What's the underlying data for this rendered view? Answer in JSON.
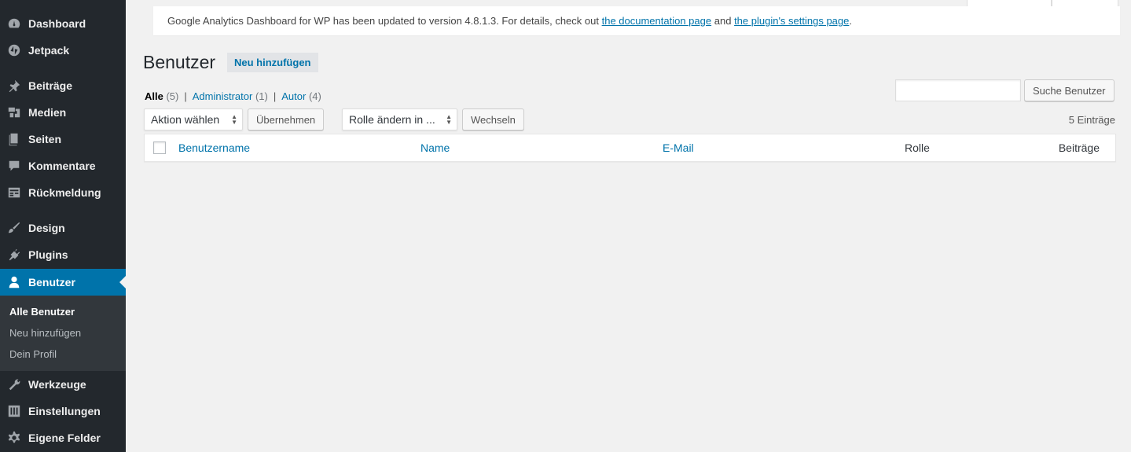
{
  "sidebar": {
    "items": [
      {
        "label": "Dashboard",
        "icon": "dashboard-icon"
      },
      {
        "label": "Jetpack",
        "icon": "jetpack-icon"
      },
      {
        "label": "Beiträge",
        "icon": "pin-icon"
      },
      {
        "label": "Medien",
        "icon": "media-icon"
      },
      {
        "label": "Seiten",
        "icon": "pages-icon"
      },
      {
        "label": "Kommentare",
        "icon": "comment-icon"
      },
      {
        "label": "Rückmeldung",
        "icon": "feedback-icon"
      },
      {
        "label": "Design",
        "icon": "brush-icon"
      },
      {
        "label": "Plugins",
        "icon": "plugin-icon"
      },
      {
        "label": "Benutzer",
        "icon": "user-icon"
      },
      {
        "label": "Werkzeuge",
        "icon": "wrench-icon"
      },
      {
        "label": "Einstellungen",
        "icon": "settings-sliders-icon"
      },
      {
        "label": "Eigene Felder",
        "icon": "gear-icon"
      }
    ],
    "submenu": [
      "Alle Benutzer",
      "Neu hinzufügen",
      "Dein Profil"
    ]
  },
  "notice": {
    "text": "Google Analytics Dashboard for WP has been updated to version 4.8.1.3. For details, check out",
    "link1": "the documentation page",
    "and": "and",
    "link2": "the plugin's settings page",
    "end": "."
  },
  "page": {
    "title": "Benutzer",
    "add_new": "Neu hinzufügen"
  },
  "filters": {
    "all": "Alle",
    "all_count": "(5)",
    "admin": "Administrator",
    "admin_count": "(1)",
    "author": "Autor",
    "author_count": "(4)",
    "sep": "|"
  },
  "search": {
    "button": "Suche Benutzer",
    "value": ""
  },
  "bulk": {
    "action_select": "Aktion wählen",
    "apply": "Übernehmen",
    "role_select": "Rolle ändern in ...",
    "change": "Wechseln",
    "count": "5 Einträge"
  },
  "table": {
    "columns": [
      "Benutzername",
      "Name",
      "E-Mail",
      "Rolle",
      "Beiträge"
    ]
  }
}
